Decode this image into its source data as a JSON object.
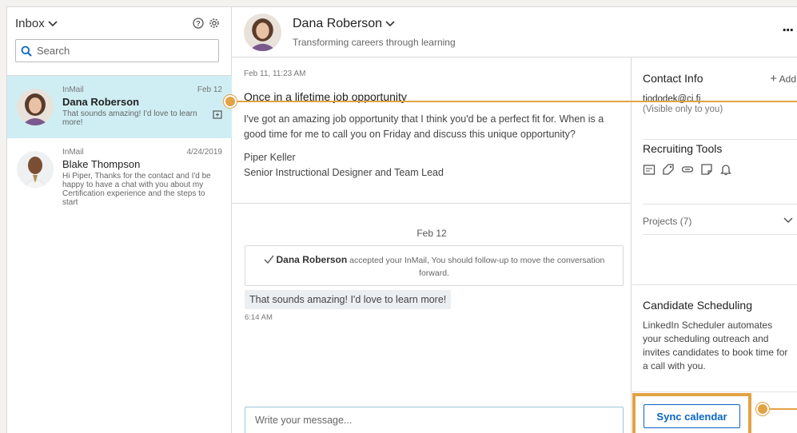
{
  "sidebar": {
    "inbox_label": "Inbox",
    "search": {
      "placeholder": "Search",
      "value": ""
    },
    "conversations": [
      {
        "type": "InMail",
        "date": "Feb 12",
        "name": "Dana Roberson",
        "snippet": "That sounds amazing! I'd love to learn more!"
      },
      {
        "type": "InMail",
        "date": "4/24/2019",
        "name": "Blake Thompson",
        "snippet": "Hi Piper, Thanks for the contact and I'd be happy to have a chat with you about my Certification experience and the steps to start"
      }
    ]
  },
  "header": {
    "name": "Dana Roberson",
    "headline": "Transforming careers through learning",
    "more_label": "..."
  },
  "thread": {
    "first_message": {
      "timestamp": "Feb 11, 11:23 AM",
      "subject": "Once in a lifetime job opportunity",
      "body": "I've got an amazing job opportunity that I think you'd be a perfect fit for. When is a good time for me to call you on Friday and discuss this unique opportunity?",
      "signature_name": "Piper Keller",
      "signature_title": "Senior Instructional Designer and Team Lead"
    },
    "day_label": "Feb 12",
    "accepted": {
      "name": "Dana Roberson",
      "text": "accepted your InMail, You should follow-up to move the conversation forward."
    },
    "reply": {
      "text": "That sounds amazing! I'd love to learn more!",
      "time": "6:14 AM"
    },
    "compose": {
      "placeholder": "Write your message...",
      "value": ""
    }
  },
  "right_panel": {
    "contact_info": {
      "title": "Contact Info",
      "add_label": "Add",
      "email": "tiododek@ci.fj",
      "visibility": "(Visible only to you)"
    },
    "recruiting_tools": {
      "title": "Recruiting Tools",
      "icons": [
        "folder-icon",
        "tag-icon",
        "link-icon",
        "note-icon",
        "bell-icon"
      ]
    },
    "projects": {
      "label": "Projects (7)"
    },
    "scheduling": {
      "title": "Candidate Scheduling",
      "description": "LinkedIn Scheduler automates your scheduling outreach and invites candidates to book time for a call with you.",
      "button_label": "Sync calendar"
    }
  },
  "colors": {
    "accent": "#0a66c2",
    "highlight": "#e2a245",
    "active_row": "#cfeef3"
  }
}
